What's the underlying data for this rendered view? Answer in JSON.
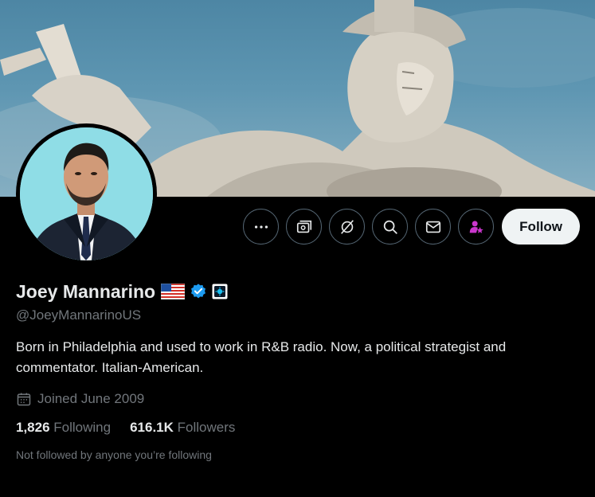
{
  "profile": {
    "name": "Joey Mannarino",
    "handle": "@JoeyMannarinoUS",
    "bio": "Born in Philadelphia and used to work in R&B radio. Now, a political strategist and commentator. Italian-American.",
    "joined": "Joined June 2009",
    "following_count": "1,826",
    "following_label": "Following",
    "followers_count": "616.1K",
    "followers_label": "Followers",
    "not_followed_text": "Not followed by anyone you’re following"
  },
  "actions": {
    "follow_label": "Follow",
    "icons": [
      "more-icon",
      "subscribe-icon",
      "grok-icon",
      "search-icon",
      "message-icon",
      "affiliate-icon"
    ]
  },
  "badges": [
    "us-flag-icon",
    "verified-icon",
    "organization-badge-icon"
  ],
  "colors": {
    "background": "#000000",
    "text_primary": "#e7e9ea",
    "text_secondary": "#71767b",
    "verified": "#1d9bf0",
    "affiliate": "#c936cc",
    "follow_button_bg": "#eff3f4"
  }
}
